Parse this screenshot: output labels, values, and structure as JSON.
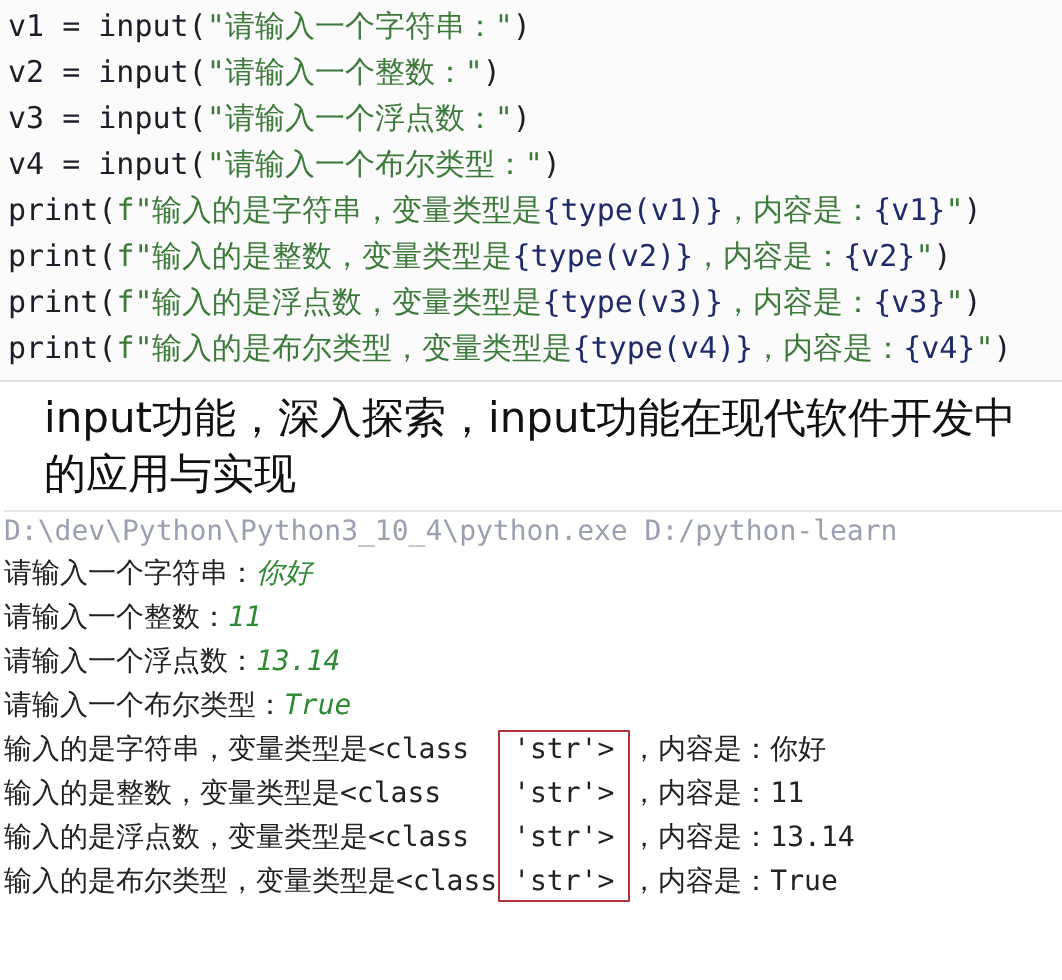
{
  "code_lines": [
    [
      {
        "text": "v1 = input(",
        "kind": "plain"
      },
      {
        "text": "\"请输入一个字符串：\"",
        "kind": "string"
      },
      {
        "text": ")",
        "kind": "plain"
      }
    ],
    [
      {
        "text": "v2 = input(",
        "kind": "plain"
      },
      {
        "text": "\"请输入一个整数：\"",
        "kind": "string"
      },
      {
        "text": ")",
        "kind": "plain"
      }
    ],
    [
      {
        "text": "v3 = input(",
        "kind": "plain"
      },
      {
        "text": "\"请输入一个浮点数：\"",
        "kind": "string"
      },
      {
        "text": ")",
        "kind": "plain"
      }
    ],
    [
      {
        "text": "v4 = input(",
        "kind": "plain"
      },
      {
        "text": "\"请输入一个布尔类型：\"",
        "kind": "string"
      },
      {
        "text": ")",
        "kind": "plain"
      }
    ],
    [
      {
        "text": "print(",
        "kind": "plain"
      },
      {
        "text": "f\"输入的是字符串，变量类型是",
        "kind": "string"
      },
      {
        "text": "{type(v1)}",
        "kind": "expr"
      },
      {
        "text": "，内容是：",
        "kind": "string"
      },
      {
        "text": "{v1}",
        "kind": "expr"
      },
      {
        "text": "\"",
        "kind": "string"
      },
      {
        "text": ")",
        "kind": "plain"
      }
    ],
    [
      {
        "text": "print(",
        "kind": "plain"
      },
      {
        "text": "f\"输入的是整数，变量类型是",
        "kind": "string"
      },
      {
        "text": "{type(v2)}",
        "kind": "expr"
      },
      {
        "text": "，内容是：",
        "kind": "string"
      },
      {
        "text": "{v2}",
        "kind": "expr"
      },
      {
        "text": "\"",
        "kind": "string"
      },
      {
        "text": ")",
        "kind": "plain"
      }
    ],
    [
      {
        "text": "print(",
        "kind": "plain"
      },
      {
        "text": "f\"输入的是浮点数，变量类型是",
        "kind": "string"
      },
      {
        "text": "{type(v3)}",
        "kind": "expr"
      },
      {
        "text": "，内容是：",
        "kind": "string"
      },
      {
        "text": "{v3}",
        "kind": "expr"
      },
      {
        "text": "\"",
        "kind": "string"
      },
      {
        "text": ")",
        "kind": "plain"
      }
    ],
    [
      {
        "text": "print(",
        "kind": "plain"
      },
      {
        "text": "f\"输入的是布尔类型，变量类型是",
        "kind": "string"
      },
      {
        "text": "{type(v4)}",
        "kind": "expr"
      },
      {
        "text": "，内容是：",
        "kind": "string"
      },
      {
        "text": "{v4}",
        "kind": "expr"
      },
      {
        "text": "\"",
        "kind": "string"
      },
      {
        "text": ")",
        "kind": "plain"
      }
    ]
  ],
  "headline": "input功能，深入探索，input功能在现代软件开发中的应用与实现",
  "console": {
    "command": "D:\\dev\\Python\\Python3_10_4\\python.exe D:/python-learn",
    "prompts": [
      {
        "prompt": "请输入一个字符串：",
        "value": "你好"
      },
      {
        "prompt": "请输入一个整数：",
        "value": "11"
      },
      {
        "prompt": "请输入一个浮点数：",
        "value": "13.14"
      },
      {
        "prompt": "请输入一个布尔类型：",
        "value": "True"
      }
    ],
    "outputs": [
      {
        "before": "输入的是字符串，变量类型是<class",
        "type_text": "'str'>",
        "after": "，内容是：你好"
      },
      {
        "before": "输入的是整数，变量类型是<class",
        "type_text": "'str'>",
        "after": "，内容是：11"
      },
      {
        "before": "输入的是浮点数，变量类型是<class",
        "type_text": "'str'>",
        "after": "，内容是：13.14"
      },
      {
        "before": "输入的是布尔类型，变量类型是<class",
        "type_text": "'str'>",
        "after": "，内容是：True"
      }
    ]
  }
}
